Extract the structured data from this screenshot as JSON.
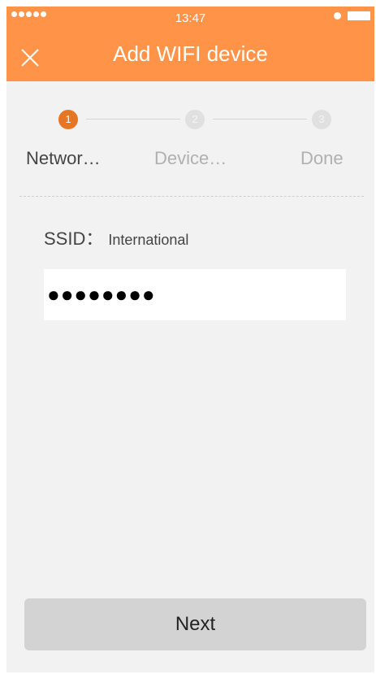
{
  "status_bar": {
    "time": "13:47"
  },
  "header": {
    "title": "Add WIFI device",
    "close_icon": "close-icon",
    "background": "#ff9448"
  },
  "steps": [
    {
      "number": "1",
      "label": "Networ…",
      "active": true
    },
    {
      "number": "2",
      "label": "Device…",
      "active": false
    },
    {
      "number": "3",
      "label": "Done",
      "active": false
    }
  ],
  "form": {
    "ssid_label": "SSID：",
    "ssid_value": "International",
    "password_value": "●●●●●●●●"
  },
  "next_button": {
    "label": "Next"
  },
  "colors": {
    "accent": "#e67524",
    "inactive_step": "#e0e0e0",
    "button_bg": "#d3d3d3"
  }
}
